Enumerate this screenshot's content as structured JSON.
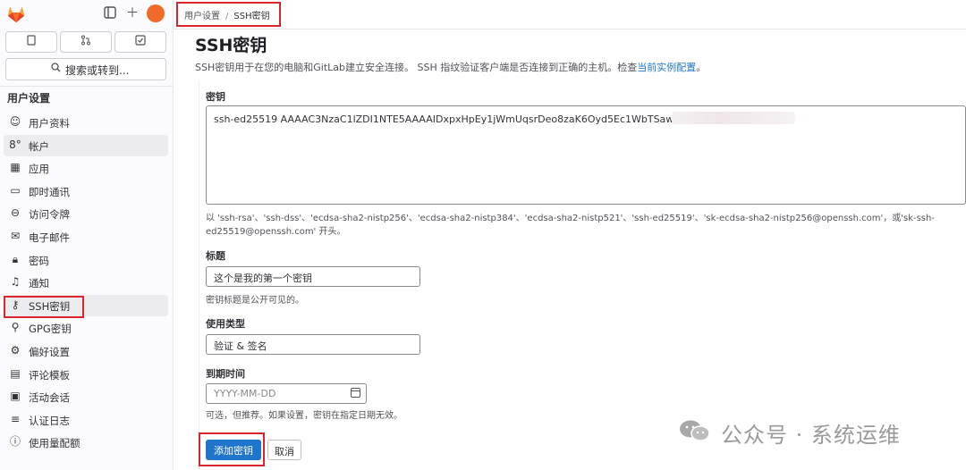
{
  "sidebar": {
    "search_label": "搜索或转到...",
    "heading": "用户设置",
    "items": [
      {
        "label": "用户资料",
        "icon": "user-icon"
      },
      {
        "label": "帐户",
        "icon": "account-icon"
      },
      {
        "label": "应用",
        "icon": "apps-icon"
      },
      {
        "label": "即时通讯",
        "icon": "chat-icon"
      },
      {
        "label": "访问令牌",
        "icon": "token-icon"
      },
      {
        "label": "电子邮件",
        "icon": "mail-icon"
      },
      {
        "label": "密码",
        "icon": "lock-icon"
      },
      {
        "label": "通知",
        "icon": "bell-icon"
      },
      {
        "label": "SSH密钥",
        "icon": "key-icon"
      },
      {
        "label": "GPG密钥",
        "icon": "gpg-key-icon"
      },
      {
        "label": "偏好设置",
        "icon": "preferences-icon"
      },
      {
        "label": "评论模板",
        "icon": "comment-template-icon"
      },
      {
        "label": "活动会话",
        "icon": "monitor-icon"
      },
      {
        "label": "认证日志",
        "icon": "log-icon"
      },
      {
        "label": "使用量配额",
        "icon": "info-icon"
      }
    ]
  },
  "breadcrumb": {
    "parent": "用户设置",
    "current": "SSH密钥"
  },
  "page": {
    "title": "SSH密钥",
    "description": "SSH密钥用于在您的电脑和GitLab建立安全连接。 SSH 指纹验证客户端是否连接到正确的主机。检查",
    "description_link": "当前实例配置",
    "description_end": "。"
  },
  "form": {
    "key_label": "密钥",
    "key_value": "ssh-ed25519 AAAAC3NzaC1lZDI1NTE5AAAAIDxpxHpEy1jWmUqsrDeo8zaK6Oyd5Ec1WbTSawPPTMtg",
    "key_hint_1": "以 'ssh-rsa'、'ssh-dss'、'ecdsa-sha2-nistp256'、'ecdsa-sha2-nistp384'、'ecdsa-sha2-nistp521'、'ssh-ed25519'、'sk-ecdsa-sha2-nistp256@openssh.com'，或'sk-ssh-",
    "key_hint_2": "ed25519@openssh.com' 开头。",
    "title_label": "标题",
    "title_value": "这个是我的第一个密钥",
    "title_hint": "密钥标题是公开可见的。",
    "usage_label": "使用类型",
    "usage_value": "验证 & 签名",
    "expiry_label": "到期时间",
    "expiry_placeholder": "YYYY-MM-DD",
    "expiry_hint": "可选，但推荐。如果设置，密钥在指定日期无效。",
    "submit_label": "添加密钥",
    "cancel_label": "取消"
  },
  "watermark": {
    "text": "公众号 · 系统运维"
  },
  "colors": {
    "primary": "#1f75cb",
    "highlight": "#d9252e",
    "brand": "#e24329"
  }
}
